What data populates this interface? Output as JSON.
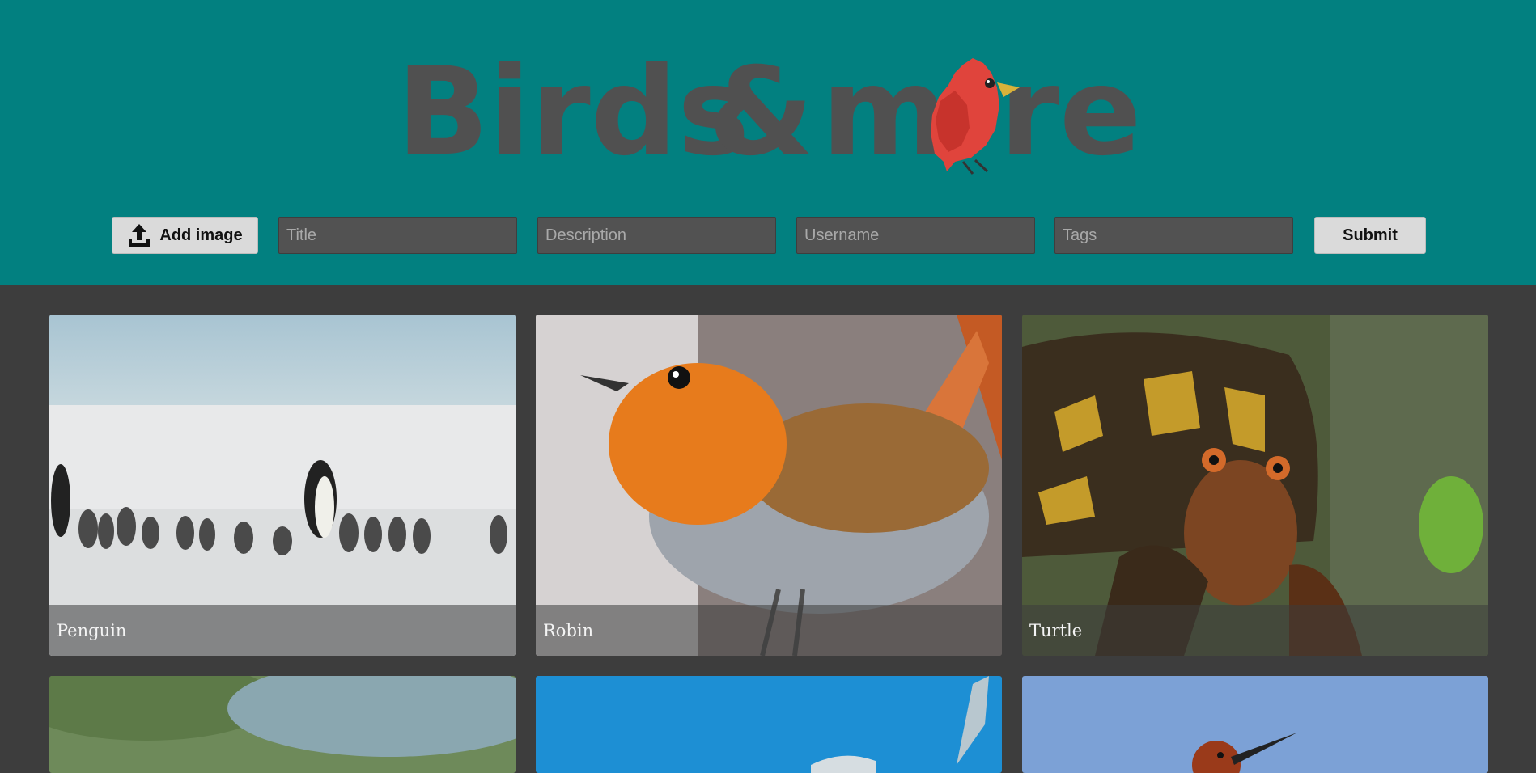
{
  "logo": {
    "part1": "Birds",
    "amp": "&",
    "part2a": "m",
    "part2b": "re"
  },
  "form": {
    "add_image_label": "Add image",
    "title_placeholder": "Title",
    "description_placeholder": "Description",
    "username_placeholder": "Username",
    "tags_placeholder": "Tags",
    "submit_label": "Submit"
  },
  "gallery": {
    "cards": [
      {
        "caption": "Penguin"
      },
      {
        "caption": "Robin"
      },
      {
        "caption": "Turtle"
      },
      {
        "caption": ""
      },
      {
        "caption": ""
      },
      {
        "caption": ""
      }
    ]
  },
  "colors": {
    "header_bg": "#028080",
    "page_bg": "#3d3d3d",
    "logo_text": "#505050",
    "logo_bird": "#e0443c"
  },
  "icons": {
    "upload": "upload-icon",
    "logo_bird": "cardinal-bird-icon"
  }
}
